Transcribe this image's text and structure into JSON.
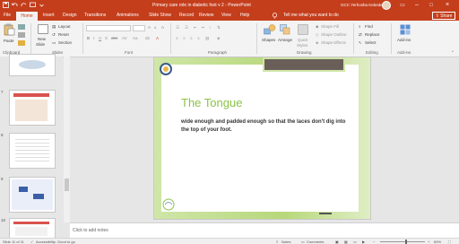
{
  "titlebar": {
    "doc_title": "Primary care role in diabetic foot v 2  -  PowerPoint",
    "user_name": "GCC Yerhosha Kebedeyet",
    "minimize": "–",
    "restore": "□",
    "close": "×"
  },
  "tabs": {
    "file": "File",
    "home": "Home",
    "insert": "Insert",
    "design": "Design",
    "transitions": "Transitions",
    "animations": "Animations",
    "slide_show": "Slide Show",
    "record": "Record",
    "review": "Review",
    "view": "View",
    "help": "Help",
    "tell_me": "Tell me what you want to do",
    "share": "Share"
  },
  "ribbon": {
    "clipboard_label": "Clipboard",
    "paste": "Paste",
    "slides_label": "Slides",
    "new_slide": "New",
    "new_slide2": "Slide",
    "layout": "Layout",
    "reset": "Reset",
    "section": "Section",
    "font_label": "Font",
    "paragraph_label": "Paragraph",
    "drawing_label": "Drawing",
    "shapes": "Shapes",
    "arrange": "Arrange",
    "quick_styles": "Quick",
    "quick_styles2": "Styles",
    "shape_fill": "Shape Fill",
    "shape_outline": "Shape Outline",
    "shape_effects": "Shape Effects",
    "editing_label": "Editing",
    "find": "Find",
    "replace": "Replace",
    "select": "Select",
    "addins_label": "Add-ins",
    "addins": "Add-ins"
  },
  "thumbnails": [
    {
      "num": "7"
    },
    {
      "num": "8"
    },
    {
      "num": "9"
    },
    {
      "num": "10"
    }
  ],
  "slide": {
    "title": "The Tongue",
    "body": "wide enough and padded enough so that the laces don't dig into the top of your foot."
  },
  "notes": {
    "placeholder": "Click to add notes"
  },
  "statusbar": {
    "slide_info": "Slide 11 of 11",
    "accessibility": "Accessibility: Good to go",
    "notes": "Notes",
    "comments": "Comments",
    "zoom": "69%"
  },
  "colors": {
    "accent": "#c43e1c",
    "slide_title": "#8bc34a"
  }
}
